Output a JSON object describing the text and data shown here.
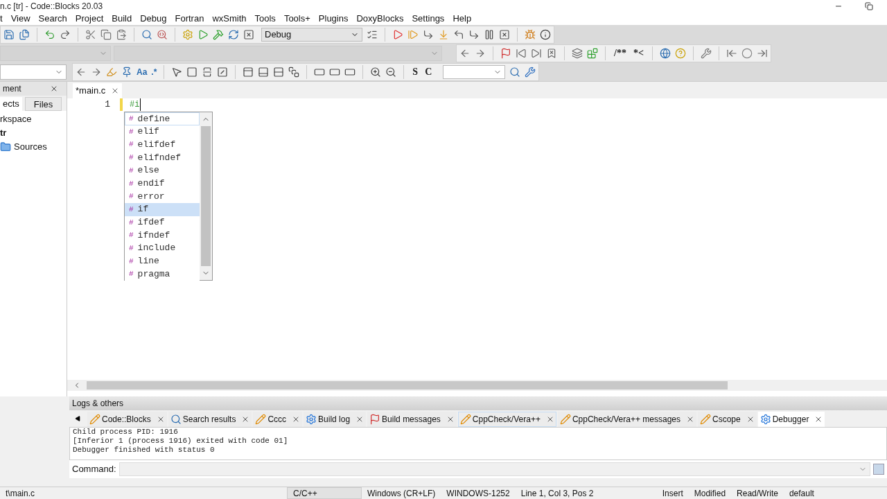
{
  "window": {
    "title": "n.c [tr] - Code::Blocks 20.03"
  },
  "menu": [
    "t",
    "View",
    "Search",
    "Project",
    "Build",
    "Debug",
    "Fortran",
    "wxSmith",
    "Tools",
    "Tools+",
    "Plugins",
    "DoxyBlocks",
    "Settings",
    "Help"
  ],
  "toolbar": {
    "build_target": "Debug",
    "text_buttons": [
      "Aa",
      ".*",
      "S",
      "C",
      "/**",
      "*<"
    ]
  },
  "management": {
    "title": "ment",
    "tabs": [
      {
        "label": "ects",
        "selected": true
      },
      {
        "label": "Files",
        "selected": false
      }
    ],
    "tree": [
      {
        "label": "rkspace",
        "bold": false,
        "children": [
          {
            "label": "tr",
            "bold": true,
            "children": [
              {
                "label": "Sources",
                "bold": false
              }
            ]
          }
        ]
      }
    ]
  },
  "editor": {
    "tab": "*main.c",
    "lines": [
      {
        "number": "1",
        "text": "#i",
        "changed": true
      }
    ],
    "autocomplete": [
      {
        "label": "define",
        "selected": false,
        "hovered": true
      },
      {
        "label": "elif",
        "selected": false,
        "hovered": false
      },
      {
        "label": "elifdef",
        "selected": false,
        "hovered": false
      },
      {
        "label": "elifndef",
        "selected": false,
        "hovered": false
      },
      {
        "label": "else",
        "selected": false,
        "hovered": false
      },
      {
        "label": "endif",
        "selected": false,
        "hovered": false
      },
      {
        "label": "error",
        "selected": false,
        "hovered": false
      },
      {
        "label": "if",
        "selected": true,
        "hovered": false
      },
      {
        "label": "ifdef",
        "selected": false,
        "hovered": false
      },
      {
        "label": "ifndef",
        "selected": false,
        "hovered": false
      },
      {
        "label": "include",
        "selected": false,
        "hovered": false
      },
      {
        "label": "line",
        "selected": false,
        "hovered": false
      },
      {
        "label": "pragma",
        "selected": false,
        "hovered": false
      }
    ],
    "marker": "#"
  },
  "logs": {
    "title": "Logs & others",
    "tabs": [
      {
        "label": "Code::Blocks",
        "kind": "text",
        "selected": false,
        "hovered": false
      },
      {
        "label": "Search results",
        "kind": "search",
        "selected": false,
        "hovered": false
      },
      {
        "label": "Cccc",
        "kind": "text",
        "selected": false,
        "hovered": false
      },
      {
        "label": "Build log",
        "kind": "gear",
        "selected": false,
        "hovered": false
      },
      {
        "label": "Build messages",
        "kind": "flag",
        "selected": false,
        "hovered": false
      },
      {
        "label": "CppCheck/Vera++",
        "kind": "text",
        "selected": false,
        "hovered": true
      },
      {
        "label": "CppCheck/Vera++ messages",
        "kind": "text",
        "selected": false,
        "hovered": false
      },
      {
        "label": "Cscope",
        "kind": "text",
        "selected": false,
        "hovered": false
      },
      {
        "label": "Debugger",
        "kind": "gear",
        "selected": true,
        "hovered": false
      }
    ],
    "lines": [
      "Child process PID: 1916",
      "[Inferior 1 (process 1916) exited with code 01]",
      "Debugger finished with status 0"
    ],
    "command_label": "Command:"
  },
  "status_bar": [
    "t\\main.c",
    "C/C++",
    "Windows (CR+LF)",
    "WINDOWS-1252",
    "Line 1, Col 3, Pos 2",
    "Insert",
    "Modified",
    "Read/Write",
    "default"
  ]
}
